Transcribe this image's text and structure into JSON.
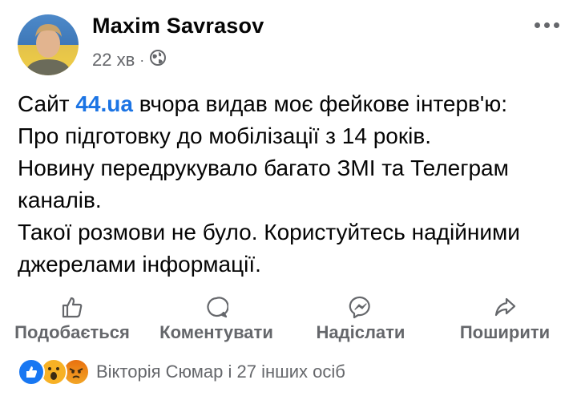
{
  "author": {
    "name": "Maxim  Savrasov",
    "time": "22 хв",
    "separator": "·",
    "audience_icon": "globe-icon"
  },
  "more_icon": "more-dots-icon",
  "post": {
    "parts": [
      {
        "text": "Сайт "
      },
      {
        "text": "44.ua",
        "link": true
      },
      {
        "text": " вчора видав моє фейкове інтерв'ю:"
      }
    ],
    "lines": [
      "Про підготовку до мобілізації з 14 років.",
      "Новину передрукувало багато ЗМІ та Телеграм каналів.",
      "Такої розмови не було. Користуйтесь надійними джерелами інформації."
    ]
  },
  "actions": [
    {
      "label": "Подобається",
      "icon": "like-icon"
    },
    {
      "label": "Коментувати",
      "icon": "comment-icon"
    },
    {
      "label": "Надіслати",
      "icon": "messenger-icon"
    },
    {
      "label": "Поширити",
      "icon": "share-icon"
    }
  ],
  "reactions": {
    "icons": [
      "like-reaction-icon",
      "wow-reaction-icon",
      "angry-reaction-icon"
    ],
    "summary": "Вікторія Сюмар і 27 інших осіб"
  },
  "colors": {
    "link": "#1b74e4",
    "muted": "#65676b",
    "like_blue": "#1877f2",
    "reaction_yellow": "#f7b125",
    "angry_red": "#e9710f"
  }
}
